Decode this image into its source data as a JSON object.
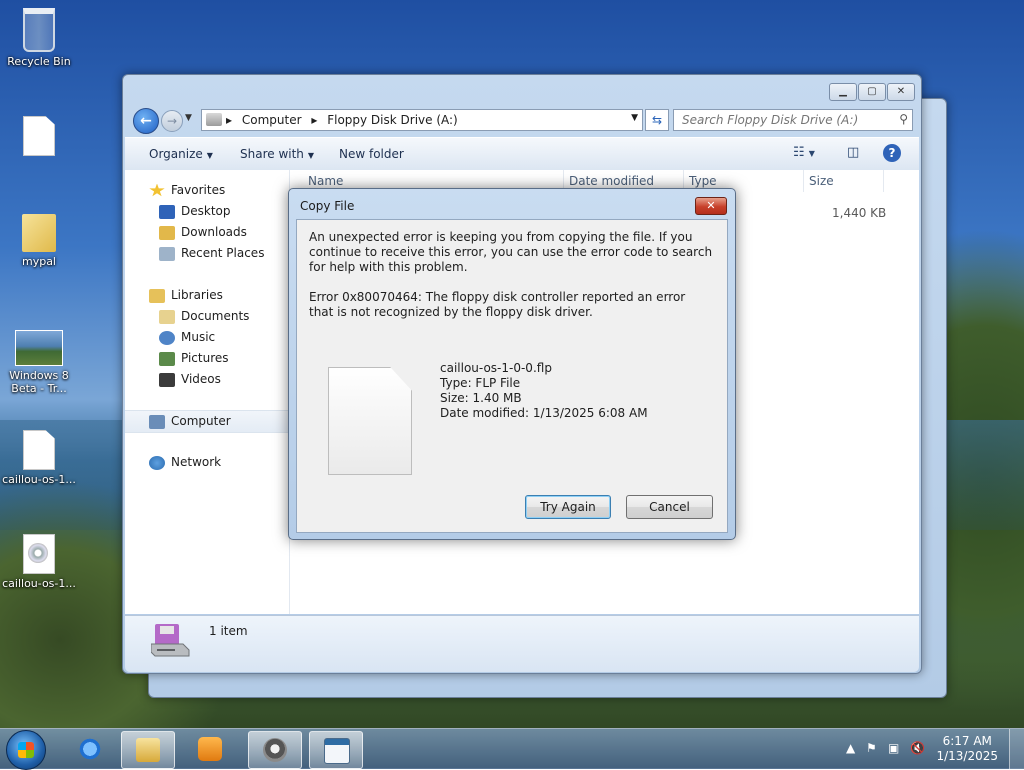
{
  "desktop": {
    "icons": [
      {
        "label": "Recycle Bin",
        "icon": "recycle-bin-icon"
      },
      {
        "label": "",
        "icon": "blank-document-icon"
      },
      {
        "label": "mypal",
        "icon": "folder-icon"
      },
      {
        "label": "Windows 8 Beta - Tr...",
        "icon": "image-thumbnail-icon"
      },
      {
        "label": "caillou-os-1...",
        "icon": "document-icon"
      },
      {
        "label": "caillou-os-1...",
        "icon": "disc-image-icon"
      }
    ]
  },
  "explorer": {
    "breadcrumb": [
      "Computer",
      "Floppy Disk Drive (A:)"
    ],
    "search_placeholder": "Search Floppy Disk Drive (A:)",
    "toolbar": {
      "organize": "Organize",
      "share_with": "Share with",
      "new_folder": "New folder"
    },
    "nav": {
      "favorites": "Favorites",
      "desktop": "Desktop",
      "downloads": "Downloads",
      "recent_places": "Recent Places",
      "libraries": "Libraries",
      "documents": "Documents",
      "music": "Music",
      "pictures": "Pictures",
      "videos": "Videos",
      "computer": "Computer",
      "network": "Network"
    },
    "columns": {
      "name": "Name",
      "date_modified": "Date modified",
      "type": "Type",
      "size": "Size"
    },
    "file_size": "1,440 KB",
    "status": "1 item"
  },
  "dialog": {
    "title": "Copy File",
    "message": "An unexpected error is keeping you from copying the file. If you continue to receive this error, you can use the error code to search for help with this problem.",
    "error": "Error 0x80070464: The floppy disk controller reported an error that is not recognized by the floppy disk driver.",
    "file_name": "caillou-os-1-0-0.flp",
    "file_type": "Type: FLP File",
    "file_size": "Size: 1.40 MB",
    "file_date": "Date modified: 1/13/2025 6:08 AM",
    "try_again": "Try Again",
    "cancel": "Cancel"
  },
  "taskbar": {
    "time": "6:17 AM",
    "date": "1/13/2025"
  }
}
